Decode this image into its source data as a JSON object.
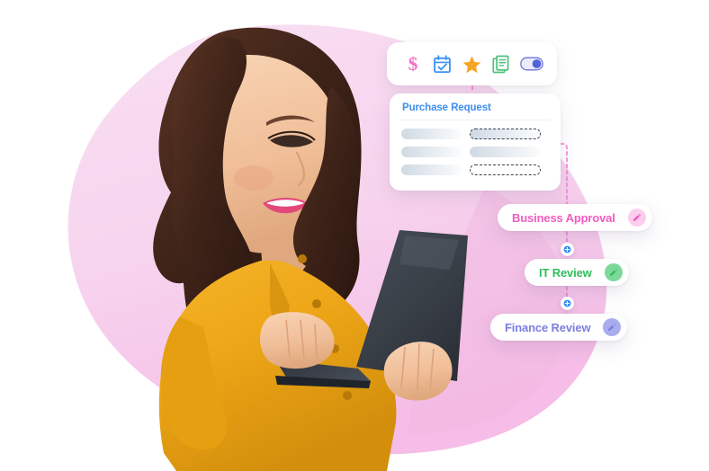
{
  "scene": {
    "title": "Workflow Automation Illustration",
    "background_color": "#ffffff",
    "blob_color_light": "#F8DDF1",
    "blob_color_deep": "#F4BCE6"
  },
  "photo": {
    "subject": "smiling-woman-holding-laptop",
    "blouse_color": "#EDA91B",
    "hair_color": "#4B2A1C",
    "laptop_color": "#3A4048",
    "skin_color": "#F2C3A0"
  },
  "icon_bar": {
    "name": "workflow-icon-toolbar",
    "icons": [
      {
        "name": "dollar-icon",
        "glyph": "$",
        "color": "#F46BC8",
        "label": "Currency"
      },
      {
        "name": "calendar-icon",
        "glyph": "📅",
        "color": "#3D92F5",
        "label": "Date"
      },
      {
        "name": "star-icon",
        "glyph": "★",
        "color": "#F5A623",
        "label": "Priority"
      },
      {
        "name": "document-icon",
        "glyph": "📄",
        "color": "#4FC37E",
        "label": "Documents"
      },
      {
        "name": "toggle-icon",
        "glyph": "◉",
        "color": "#4F63D8",
        "label": "Toggle",
        "state": "on"
      }
    ]
  },
  "purchase_request_card": {
    "title": "Purchase Request",
    "title_color": "#3D8FEF",
    "rows": [
      {
        "left": "field-label-placeholder",
        "right": "field-input-filled-dashed"
      },
      {
        "left": "field-label-placeholder",
        "right": "field-input-filled"
      },
      {
        "left": "field-label-placeholder",
        "right": "field-input-empty-dashed"
      }
    ]
  },
  "workflow": {
    "steps": [
      {
        "id": "business-approval",
        "label": "Business Approval",
        "color": "#F25BC0",
        "edit_bg": "#FBCFEC",
        "edit_icon": "pencil-icon"
      },
      {
        "id": "it-review",
        "label": "IT Review",
        "color": "#2FBF5C",
        "edit_bg": "#7DD99A",
        "edit_icon": "pencil-icon"
      },
      {
        "id": "finance-review",
        "label": "Finance Review",
        "color": "#7B7FE0",
        "edit_bg": "#A9ADEE",
        "edit_icon": "pencil-icon"
      }
    ],
    "connector_color": "#EE7FD2",
    "node_color": "#2F8BF5",
    "nodes": [
      {
        "id": "add-node-1",
        "glyph": "+"
      },
      {
        "id": "add-node-2",
        "glyph": "+"
      }
    ]
  }
}
